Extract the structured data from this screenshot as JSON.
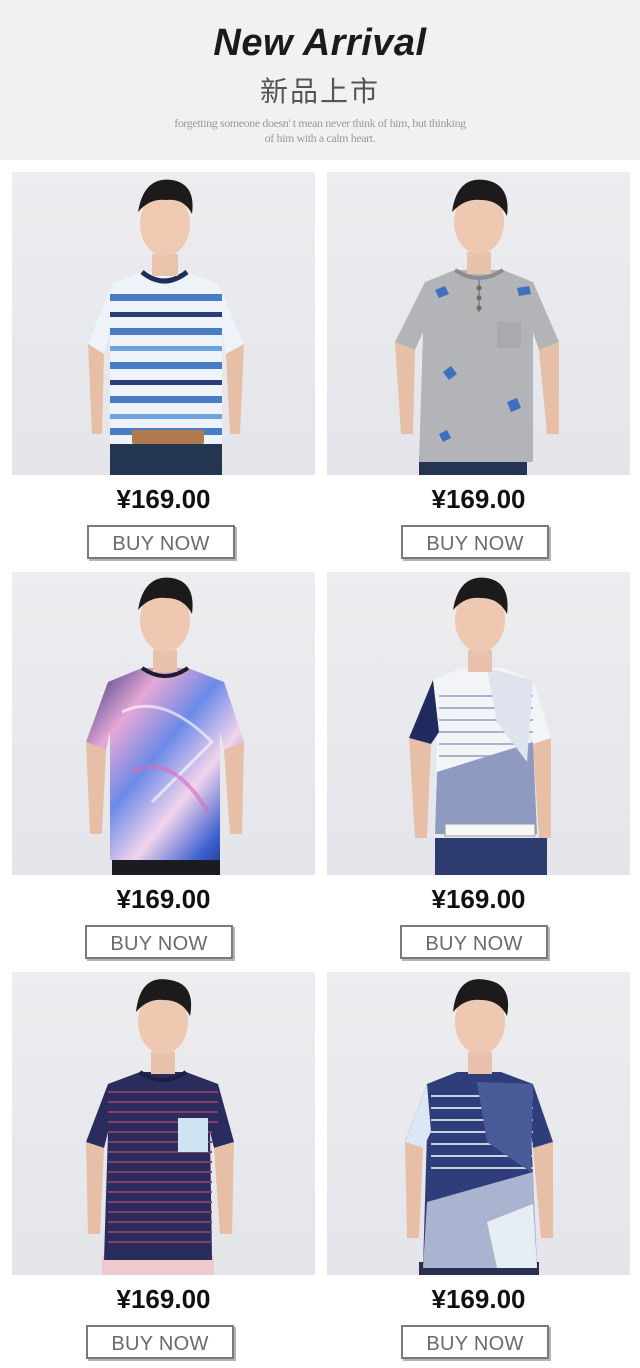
{
  "header": {
    "title": "New Arrival",
    "subtitle": "新品上市",
    "tagline_1": "forgetting someone doesn' t mean never think of him, but thinking",
    "tagline_2": "of him with a calm heart."
  },
  "products": [
    {
      "price": "¥169.00",
      "button": "BUY NOW",
      "shirt": "blue-stripe-tee-icon"
    },
    {
      "price": "¥169.00",
      "button": "BUY NOW",
      "shirt": "grey-henley-tee-icon"
    },
    {
      "price": "¥169.00",
      "button": "BUY NOW",
      "shirt": "marble-print-tee-icon"
    },
    {
      "price": "¥169.00",
      "button": "BUY NOW",
      "shirt": "patchwork-stripe-tee-icon"
    },
    {
      "price": "¥169.00",
      "button": "BUY NOW",
      "shirt": "navy-stripe-pocket-tee-icon"
    },
    {
      "price": "¥169.00",
      "button": "BUY NOW",
      "shirt": "navy-patchwork-tee-icon"
    }
  ],
  "colors": {
    "header_bg": "#f1f1f1",
    "photo_bg": "#e8e9ed",
    "button_border": "#7a7a7a"
  }
}
